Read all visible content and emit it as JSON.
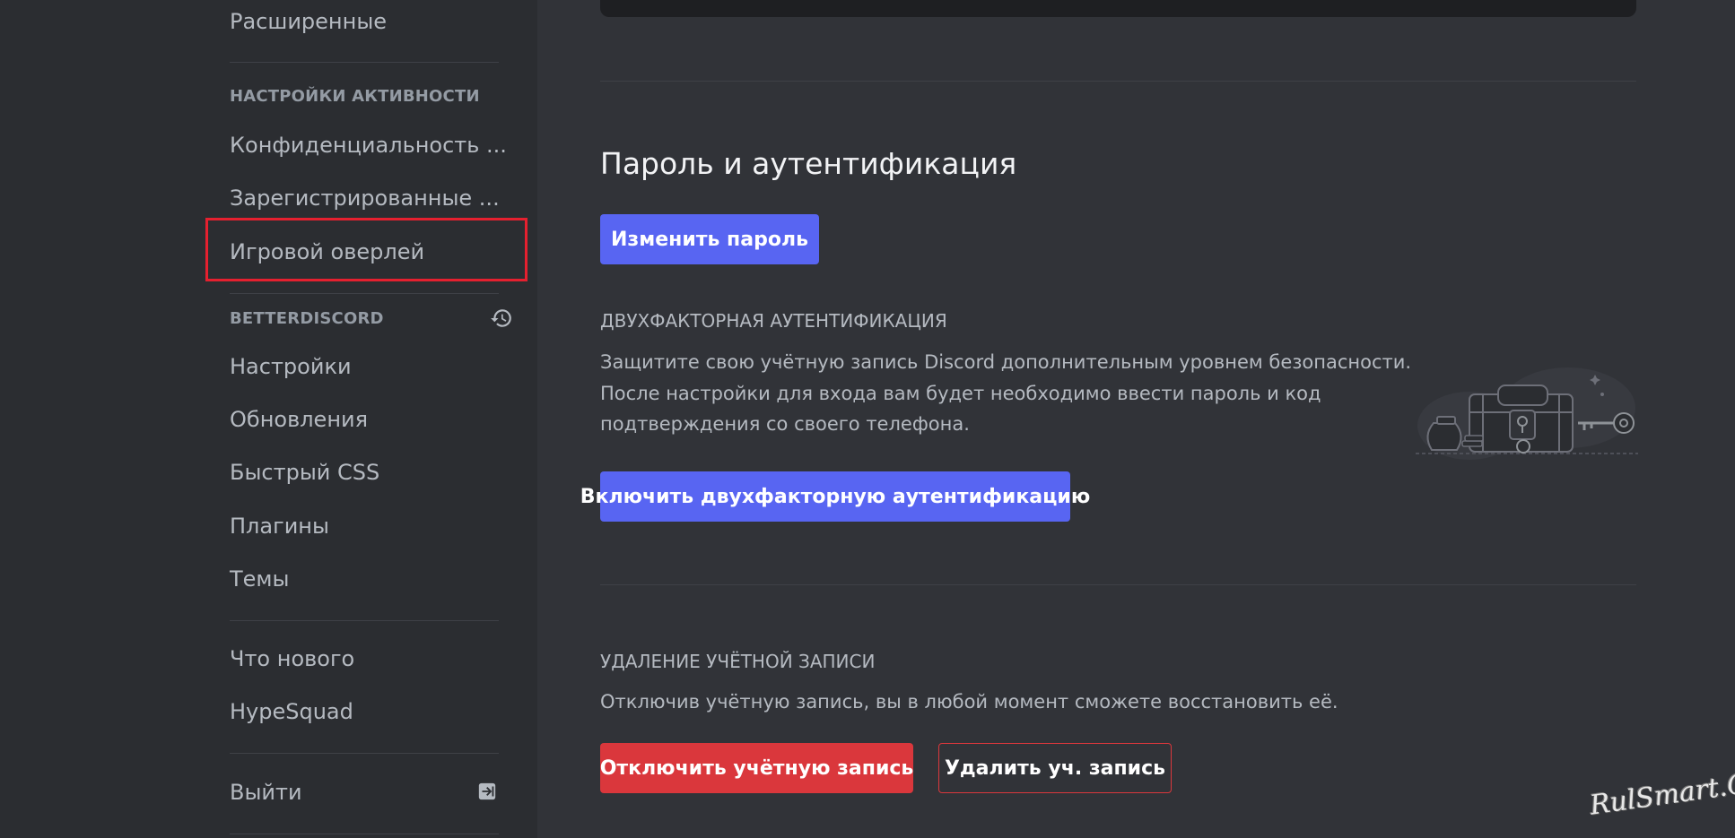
{
  "sidebar": {
    "item_advanced": "Расширенные",
    "activity_header": "НАСТРОЙКИ АКТИВНОСТИ",
    "activity_privacy": "Конфиденциальность ...",
    "registered_games": "Зарегистрированные ...",
    "game_overlay": "Игровой оверлей",
    "betterdiscord_header": "BETTERDISCORD",
    "bd_settings": "Настройки",
    "bd_updates": "Обновления",
    "bd_custom_css": "Быстрый CSS",
    "bd_plugins": "Плагины",
    "bd_themes": "Темы",
    "whats_new": "Что нового",
    "hypesquad": "HypeSquad",
    "logout": "Выйти",
    "icons": {
      "history": "history-icon",
      "logout": "logout-icon"
    }
  },
  "main": {
    "password_section_title": "Пароль и аутентификация",
    "change_password_button": "Изменить пароль",
    "two_factor_header": "ДВУХФАКТОРНАЯ АУТЕНТИФИКАЦИЯ",
    "two_factor_desc_line1": "Защитите свою учётную запись Discord дополнительным уровнем безопасности.",
    "two_factor_desc_line2": "После настройки для входа вам будет необходимо ввести пароль и код",
    "two_factor_desc_line3": "подтверждения со своего телефона.",
    "enable_2fa_button": "Включить двухфакторную аутентификацию",
    "account_removal_header": "УДАЛЕНИЕ УЧЁТНОЙ ЗАПИСИ",
    "account_removal_desc": "Отключив учётную запись, вы в любой момент сможете восстановить её.",
    "disable_account_button": "Отключить учётную запись",
    "delete_account_button": "Удалить уч. запись"
  },
  "watermark": "RulSmart.Com",
  "colors": {
    "sidebar_bg": "#2b2d31",
    "main_bg": "#313338",
    "brand": "#5865f2",
    "danger": "#da373c",
    "highlight": "#e5202f"
  }
}
